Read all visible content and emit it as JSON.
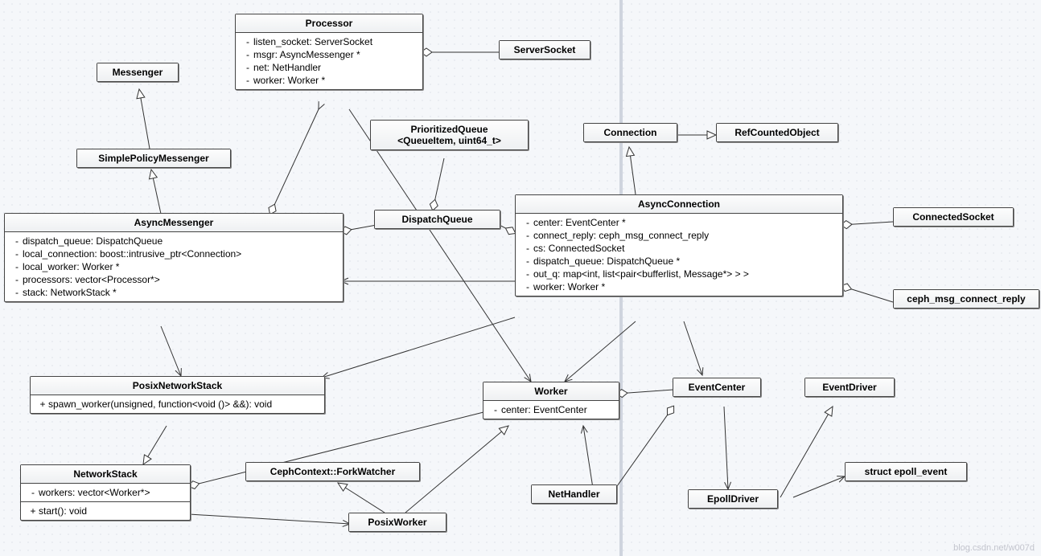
{
  "classes": {
    "messenger": {
      "name": "Messenger"
    },
    "simplepolicy": {
      "name": "SimplePolicyMessenger"
    },
    "processor": {
      "name": "Processor",
      "attrs": [
        {
          "v": "-",
          "t": "listen_socket: ServerSocket"
        },
        {
          "v": "-",
          "t": "msgr: AsyncMessenger *"
        },
        {
          "v": "-",
          "t": "net: NetHandler"
        },
        {
          "v": "-",
          "t": "worker: Worker *"
        }
      ]
    },
    "serversocket": {
      "name": "ServerSocket"
    },
    "prioritized": {
      "name": "PrioritizedQueue",
      "tpl": "<QueueItem, uint64_t>"
    },
    "connection": {
      "name": "Connection"
    },
    "refcounted": {
      "name": "RefCountedObject"
    },
    "asyncmsgr": {
      "name": "AsyncMessenger",
      "attrs": [
        {
          "v": "-",
          "t": "dispatch_queue: DispatchQueue"
        },
        {
          "v": "-",
          "t": "local_connection: boost::intrusive_ptr<Connection>"
        },
        {
          "v": "-",
          "t": "local_worker: Worker *"
        },
        {
          "v": "-",
          "t": "processors: vector<Processor*>"
        },
        {
          "v": "-",
          "t": "stack: NetworkStack *"
        }
      ]
    },
    "dispatchq": {
      "name": "DispatchQueue"
    },
    "asyncconn": {
      "name": "AsyncConnection",
      "attrs": [
        {
          "v": "-",
          "t": "center: EventCenter *"
        },
        {
          "v": "-",
          "t": "connect_reply: ceph_msg_connect_reply"
        },
        {
          "v": "-",
          "t": "cs: ConnectedSocket"
        },
        {
          "v": "-",
          "t": "dispatch_queue: DispatchQueue *"
        },
        {
          "v": "-",
          "t": "out_q: map<int, list<pair<bufferlist, Message*> > >"
        },
        {
          "v": "-",
          "t": "worker: Worker *"
        }
      ]
    },
    "connectedsocket": {
      "name": "ConnectedSocket"
    },
    "cephreply": {
      "name": "ceph_msg_connect_reply"
    },
    "posixnet": {
      "name": "PosixNetworkStack",
      "ops": [
        {
          "v": "+",
          "t": "spawn_worker(unsigned, function<void ()> &&): void"
        }
      ]
    },
    "worker": {
      "name": "Worker",
      "attrs": [
        {
          "v": "-",
          "t": "center: EventCenter"
        }
      ]
    },
    "eventcenter": {
      "name": "EventCenter"
    },
    "eventdriver": {
      "name": "EventDriver"
    },
    "networkstack": {
      "name": "NetworkStack",
      "attrs": [
        {
          "v": "-",
          "t": "workers: vector<Worker*>"
        }
      ],
      "ops": [
        {
          "v": "+",
          "t": "start(): void"
        }
      ]
    },
    "forkwatcher": {
      "name": "CephContext::ForkWatcher"
    },
    "nethandler": {
      "name": "NetHandler"
    },
    "epolldriver": {
      "name": "EpollDriver"
    },
    "epollevent": {
      "name": "struct epoll_event"
    },
    "posixworker": {
      "name": "PosixWorker"
    }
  },
  "watermark": "blog.csdn.net/w007d"
}
